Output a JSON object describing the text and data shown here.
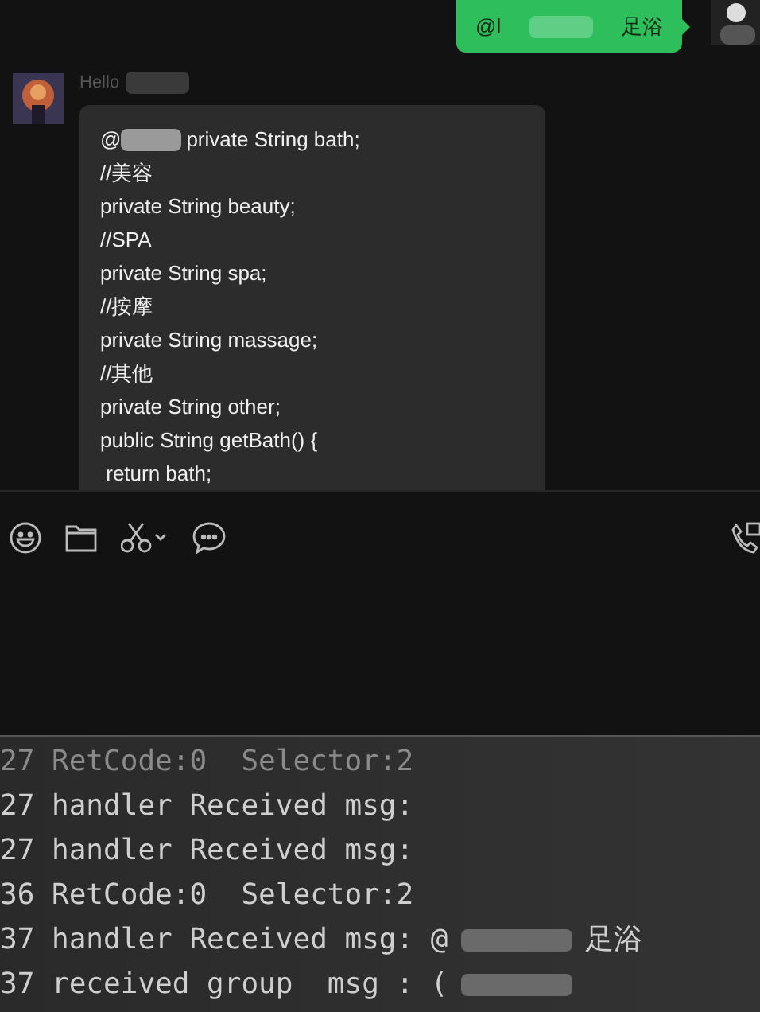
{
  "chat": {
    "outgoing": {
      "segments": [
        "@l",
        "足浴"
      ]
    },
    "incoming": {
      "sender": {
        "segments": [
          "Hello"
        ],
        "redacted_end": true
      },
      "code_lines": [
        {
          "segments": [
            "@",
            "private String bath;"
          ]
        },
        {
          "segments": [
            "//美容"
          ]
        },
        {
          "segments": [
            "private String beauty;"
          ]
        },
        {
          "segments": [
            "//SPA"
          ]
        },
        {
          "segments": [
            "private String spa;"
          ]
        },
        {
          "segments": [
            "//按摩"
          ]
        },
        {
          "segments": [
            "private String massage;"
          ]
        },
        {
          "segments": [
            "//其他"
          ]
        },
        {
          "segments": [
            "private String other;"
          ]
        },
        {
          "segments": [
            "public String getBath() {"
          ]
        },
        {
          "segments": [
            " return bath;"
          ]
        }
      ]
    }
  },
  "toolbar": [
    {
      "kind": "emoji"
    },
    {
      "kind": "folder"
    },
    {
      "kind": "scissors"
    },
    {
      "kind": "chat"
    },
    {
      "kind": "call"
    }
  ],
  "console": {
    "lines": [
      {
        "segments": [
          "27 RetCode:0  Selector:2"
        ],
        "dim": true
      },
      {
        "segments": [
          "27 handler Received msg:"
        ],
        "dim": false
      },
      {
        "segments": [
          "27 handler Received msg:"
        ],
        "dim": false
      },
      {
        "segments": [
          "36 RetCode:0  Selector:2"
        ],
        "dim": false
      },
      {
        "segments": [
          "37 handler Received msg: @",
          "足浴"
        ],
        "dim": false
      },
      {
        "segments": [
          "37 received group  msg : ("
        ],
        "dim": false,
        "redacted_end": true
      }
    ]
  }
}
